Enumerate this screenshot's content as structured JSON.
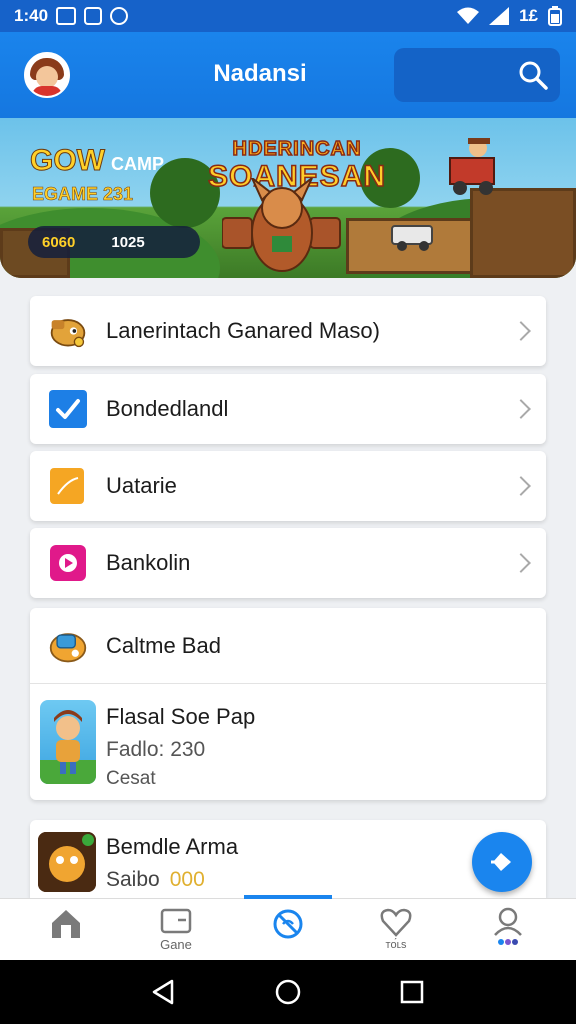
{
  "status_bar": {
    "time": "1:40",
    "right_text": "1£"
  },
  "header": {
    "title": "Nadansi"
  },
  "banner": {
    "title_line1": "HDERINCAN",
    "title_line2": "SOANESAN",
    "gow_text": "GOW",
    "camp_text": "CAMP",
    "game_text": "EGAME 231",
    "score_left": "6060",
    "score_right": "1025"
  },
  "menu": [
    {
      "label": "Lanerintach Ganared Maso)",
      "icon": "game-character-icon"
    },
    {
      "label": "Bondedlandl",
      "icon": "checkbox-icon"
    },
    {
      "label": "Uatarie",
      "icon": "folder-icon"
    },
    {
      "label": "Bankolin",
      "icon": "record-icon"
    }
  ],
  "section": {
    "header_label": "Caltme Bad",
    "game_title": "Flasal Soe Pap",
    "game_line2": "Fadlo: 230",
    "game_line3": "Cesat"
  },
  "bottom_card": {
    "title": "Bemdle Arma",
    "subtitle": "Saibo",
    "coin_text": "000"
  },
  "bottom_nav": {
    "items": [
      {
        "label": "",
        "icon": "home-icon"
      },
      {
        "label": "Gane",
        "icon": "wallet-icon"
      },
      {
        "label": "",
        "icon": "no-signal-icon"
      },
      {
        "label": "ᴛᴏ́ʟs",
        "icon": "heart-icon"
      },
      {
        "label": "",
        "icon": "profile-icon"
      }
    ]
  },
  "colors": {
    "primary": "#1a85ee",
    "header": "#1577e0",
    "status": "#1662c9"
  }
}
